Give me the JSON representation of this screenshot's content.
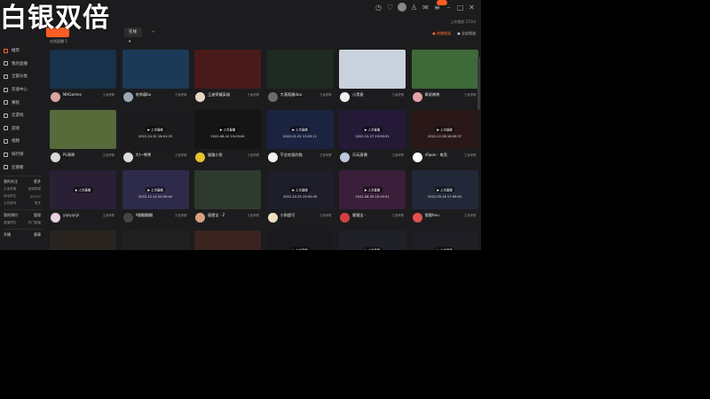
{
  "watermark": "白银双倍",
  "topbar": {
    "subtitle": "上次播放 27/04"
  },
  "filter": {
    "chip_active": "",
    "chip_category": "在线 ▾",
    "chip_plus": "+",
    "hot_label": "● 热播频道",
    "more_label": "● 全部频道",
    "crumb": "在线直播 5"
  },
  "sidebar": {
    "items": [
      {
        "label": "推荐"
      },
      {
        "label": "我的直播"
      },
      {
        "label": "全部分类"
      },
      {
        "label": "充值中心"
      },
      {
        "label": "赛程"
      },
      {
        "label": "云游戏"
      },
      {
        "label": "游戏"
      },
      {
        "label": "视频"
      },
      {
        "label": "排行榜"
      },
      {
        "label": "近期看"
      }
    ],
    "section1": {
      "title": "我的关注",
      "action": "更多"
    },
    "section1_rows": [
      [
        "王者荣耀",
        "英雄联盟"
      ],
      [
        "绝地求生",
        "DOTA2"
      ],
      [
        "主机游戏",
        "更多"
      ]
    ],
    "section2": {
      "title": "我的预约",
      "action": "管理"
    },
    "section2_rows": [
      [
        "直播预告",
        "热门直播"
      ]
    ],
    "bottom": {
      "left": "开播",
      "right": "赛事"
    }
  },
  "cards": [
    {
      "name": "NHGames",
      "tag": "王者荣耀",
      "sub": "",
      "views": "",
      "center": "",
      "date": "",
      "bg": "#17324a",
      "ava": "#d9a4a0"
    },
    {
      "name": "老帅逼bu",
      "tag": "王者荣耀",
      "sub": "",
      "views": "",
      "center": "",
      "date": "",
      "bg": "#1c3a58",
      "ava": "#9aa8b8"
    },
    {
      "name": "王者荣耀英雄",
      "tag": "王者荣耀",
      "sub": "",
      "views": "",
      "center": "",
      "date": "",
      "bg": "#4a1a1a",
      "ava": "#e6d6c6"
    },
    {
      "name": "大漠孤烟dou",
      "tag": "王者荣耀",
      "sub": "",
      "views": "",
      "center": "",
      "date": "",
      "bg": "#1e2a22",
      "ava": "#6b6b6b"
    },
    {
      "name": "小黑屋",
      "tag": "王者荣耀",
      "sub": "",
      "views": "",
      "center": "",
      "date": "",
      "bg": "#c9d2dc",
      "ava": "#f0f0f0"
    },
    {
      "name": "解说晓晓",
      "tag": "王者荣耀",
      "sub": "",
      "views": "",
      "center": "",
      "date": "",
      "bg": "#3e6a3a",
      "ava": "#e6a0a8"
    },
    {
      "name": "PL哥哥",
      "tag": "王者荣耀",
      "sub": "",
      "views": "",
      "center": "",
      "date": "",
      "bg": "#566a3a",
      "ava": "#d9d9d9"
    },
    {
      "name": "大l～熊熊",
      "tag": "王者荣耀",
      "sub": "",
      "views": "",
      "center": "▶ 上次直播",
      "date": "2022-10-31 16:01:25",
      "bg": "#1b1b1d",
      "ava": "#dcdcdc"
    },
    {
      "name": "猫猫小鱼",
      "tag": "王者荣耀",
      "sub": "",
      "views": "",
      "center": "▶ 上次直播",
      "date": "2022-06-10 15:03:04",
      "bg": "#151515",
      "ava": "#e8c230"
    },
    {
      "name": "不会吃饭的猫",
      "tag": "王者荣耀",
      "sub": "",
      "views": "",
      "center": "▶ 上次直播",
      "date": "2022-01-01 13:25:11",
      "bg": "#1a2440",
      "ava": "#f0f0f0"
    },
    {
      "name": "乐玩直播",
      "tag": "王者荣耀",
      "sub": "",
      "views": "",
      "center": "▶ 上次直播",
      "date": "2022-12-27 19:59:51",
      "bg": "#241a38",
      "ava": "#bcc6dc"
    },
    {
      "name": "Vlipon · 电竞",
      "tag": "王者荣耀",
      "sub": "",
      "views": "",
      "center": "▶ 上次直播",
      "date": "2022-12-28 18:09:37",
      "bg": "#2a1818",
      "ava": "#ffffff"
    },
    {
      "name": "yiyiyiyiyi",
      "tag": "王者荣耀",
      "sub": "",
      "views": "",
      "center": "▶ 上次直播",
      "date": "",
      "bg": "#2a2036",
      "ava": "#e8d0e0"
    },
    {
      "name": "A翻翻翻翻",
      "tag": "王者荣耀",
      "sub": "",
      "views": "",
      "center": "▶ 上次直播",
      "date": "2022-12-14 20:20:44",
      "bg": "#2d2a4a",
      "ava": "#444444"
    },
    {
      "name": "甜甜宝 · Z",
      "tag": "王者荣耀",
      "sub": "",
      "views": "",
      "center": "",
      "date": "",
      "bg": "#2e3a2e",
      "ava": "#d9a080"
    },
    {
      "name": "小狗超可",
      "tag": "王者荣耀",
      "sub": "",
      "views": "",
      "center": "▶ 上次直播",
      "date": "2022-10-25 19:52:09",
      "bg": "#1e1e2a",
      "ava": "#efe0c0"
    },
    {
      "name": "猫猫宝 ·",
      "tag": "王者荣耀",
      "sub": "",
      "views": "",
      "center": "▶ 上次直播",
      "date": "2022-08-29 20:19:51",
      "bg": "#3a1e3a",
      "ava": "#d04040"
    },
    {
      "name": "猫猫hou",
      "tag": "王者荣耀",
      "sub": "",
      "views": "",
      "center": "▶ 上次直播",
      "date": "2022-09-18 17:09:04",
      "bg": "#222838",
      "ava": "#e05050"
    },
    {
      "name": "",
      "tag": "",
      "sub": "",
      "views": "",
      "center": "",
      "date": "",
      "bg": "#2a2420",
      "ava": "#333"
    },
    {
      "name": "",
      "tag": "",
      "sub": "",
      "views": "",
      "center": "",
      "date": "",
      "bg": "#202020",
      "ava": "#333"
    },
    {
      "name": "",
      "tag": "",
      "sub": "",
      "views": "",
      "center": "",
      "date": "",
      "bg": "#3a2420",
      "ava": "#333"
    },
    {
      "name": "",
      "tag": "",
      "sub": "",
      "views": "",
      "center": "▶ 上次直播",
      "date": "",
      "bg": "#1a1a1e",
      "ava": "#333"
    },
    {
      "name": "",
      "tag": "",
      "sub": "",
      "views": "",
      "center": "▶ 上次直播",
      "date": "",
      "bg": "#202028",
      "ava": "#333"
    },
    {
      "name": "",
      "tag": "",
      "sub": "",
      "views": "",
      "center": "▶ 上次直播",
      "date": "",
      "bg": "#1e1e24",
      "ava": "#333"
    }
  ]
}
